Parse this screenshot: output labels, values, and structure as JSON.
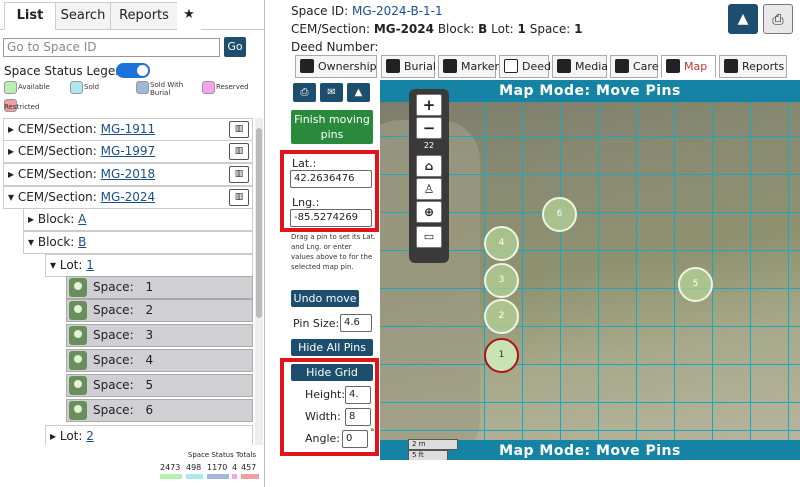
{
  "left": {
    "tabs": [
      "List",
      "Search",
      "Reports",
      "★"
    ],
    "goto_placeholder": "Go to Space ID",
    "go_label": "Go",
    "legend_title": "Space Status Legend:",
    "legend": [
      {
        "label": "Available",
        "color": "#b9efb0"
      },
      {
        "label": "Sold",
        "color": "#aee8ef"
      },
      {
        "label": "Sold With Burial",
        "color": "#9fb7da"
      },
      {
        "label": "Reserved",
        "color": "#f2a4ee"
      },
      {
        "label": "Restricted",
        "color": "#f19ea3"
      }
    ],
    "tree": {
      "section_prefix": "CEM/Section:",
      "sections": [
        "MG-1911",
        "MG-1997",
        "MG-2018",
        "MG-2024"
      ],
      "block_prefix": "Block:",
      "blocks": [
        "A",
        "B"
      ],
      "lot_prefix": "Lot:",
      "lots": [
        "1",
        "2"
      ],
      "space_prefix": "Space:",
      "spaces": [
        "1",
        "2",
        "3",
        "4",
        "5",
        "6"
      ]
    },
    "totals_title": "Space Status Totals",
    "totals": [
      {
        "value": "2473",
        "color": "#b9efb0"
      },
      {
        "value": "498",
        "color": "#aee8ef"
      },
      {
        "value": "1170",
        "color": "#9fb7da"
      },
      {
        "value": "4",
        "color": "#f2a4ee"
      },
      {
        "value": "457",
        "color": "#f19ea3"
      }
    ]
  },
  "header": {
    "space_id_label": "Space ID:",
    "space_id": "MG-2024-B-1-1",
    "section_label": "CEM/Section:",
    "section": "MG-2024",
    "block_label": "Block:",
    "block": "B",
    "lot_label": "Lot:",
    "lot": "1",
    "space_label": "Space:",
    "space": "1",
    "deed_label": "Deed Number:"
  },
  "tabs": [
    "Ownership",
    "Burial",
    "Marker",
    "Deed",
    "Media",
    "Care",
    "Map",
    "Reports"
  ],
  "controls": {
    "finish_label": "Finish moving pins",
    "lat_label": "Lat.:",
    "lat_value": "42.2636476",
    "lng_label": "Lng.:",
    "lng_value": "-85.5274269",
    "help_text": "Drag a pin to set its Lat. and Lng. or enter values above to for the selected map pin.",
    "undo_label": "Undo move",
    "pin_size_label": "Pin Size:",
    "pin_size_value": "4.6",
    "hide_pins_label": "Hide All Pins",
    "hide_grid_label": "Hide Grid",
    "height_label": "Height:",
    "height_value": "4.",
    "width_label": "Width:",
    "width_value": "8",
    "angle_label": "Angle:",
    "angle_value": "0",
    "degree": "°"
  },
  "map": {
    "mode_label": "Map Mode: Move Pins",
    "zoom_level": "22",
    "scale_m": "2 m",
    "scale_ft": "5 ft",
    "pins": [
      "1",
      "2",
      "3",
      "4",
      "5",
      "6"
    ]
  },
  "colors": {
    "accent": "#1e4e6e",
    "map_bar": "#1583a3",
    "grid": "#17a8c4",
    "highlight": "#e0151b"
  }
}
